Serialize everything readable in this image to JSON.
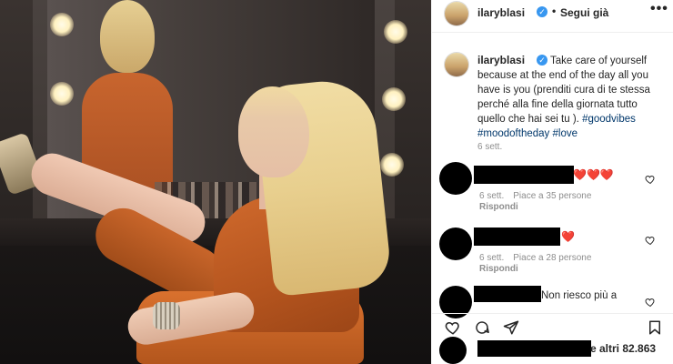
{
  "header": {
    "username": "ilaryblasi",
    "separator": "•",
    "follow_status": "Segui già",
    "more": "•••"
  },
  "caption": {
    "username": "ilaryblasi",
    "text_main": "Take care of yourself because at the end of the day all you have is you (prenditi cura di te stessa perché alla fine della giornata tutto quello che hai sei tu ). ",
    "hashtags": [
      "#goodvibes",
      "#moodoftheday",
      "#love"
    ],
    "time": "6 sett."
  },
  "comments": [
    {
      "hearts": "❤️❤️❤️",
      "time": "6 sett.",
      "likes": "Piace a 35 persone",
      "reply": "Rispondi"
    },
    {
      "hearts": "❤️",
      "time": "6 sett.",
      "likes": "Piace a 28 persone",
      "reply": "Rispondi"
    },
    {
      "text": "Non riesco più a"
    }
  ],
  "likes": {
    "text": "e altri 82.863"
  },
  "icons": {
    "verified": "verified-badge-icon",
    "like": "heart-icon",
    "comment": "comment-icon",
    "share": "share-icon",
    "save": "bookmark-icon"
  },
  "colors": {
    "verified": "#3897f0",
    "heart": "#ed4956",
    "hashtag": "#00376b",
    "secondary_text": "#8e8e8e"
  }
}
